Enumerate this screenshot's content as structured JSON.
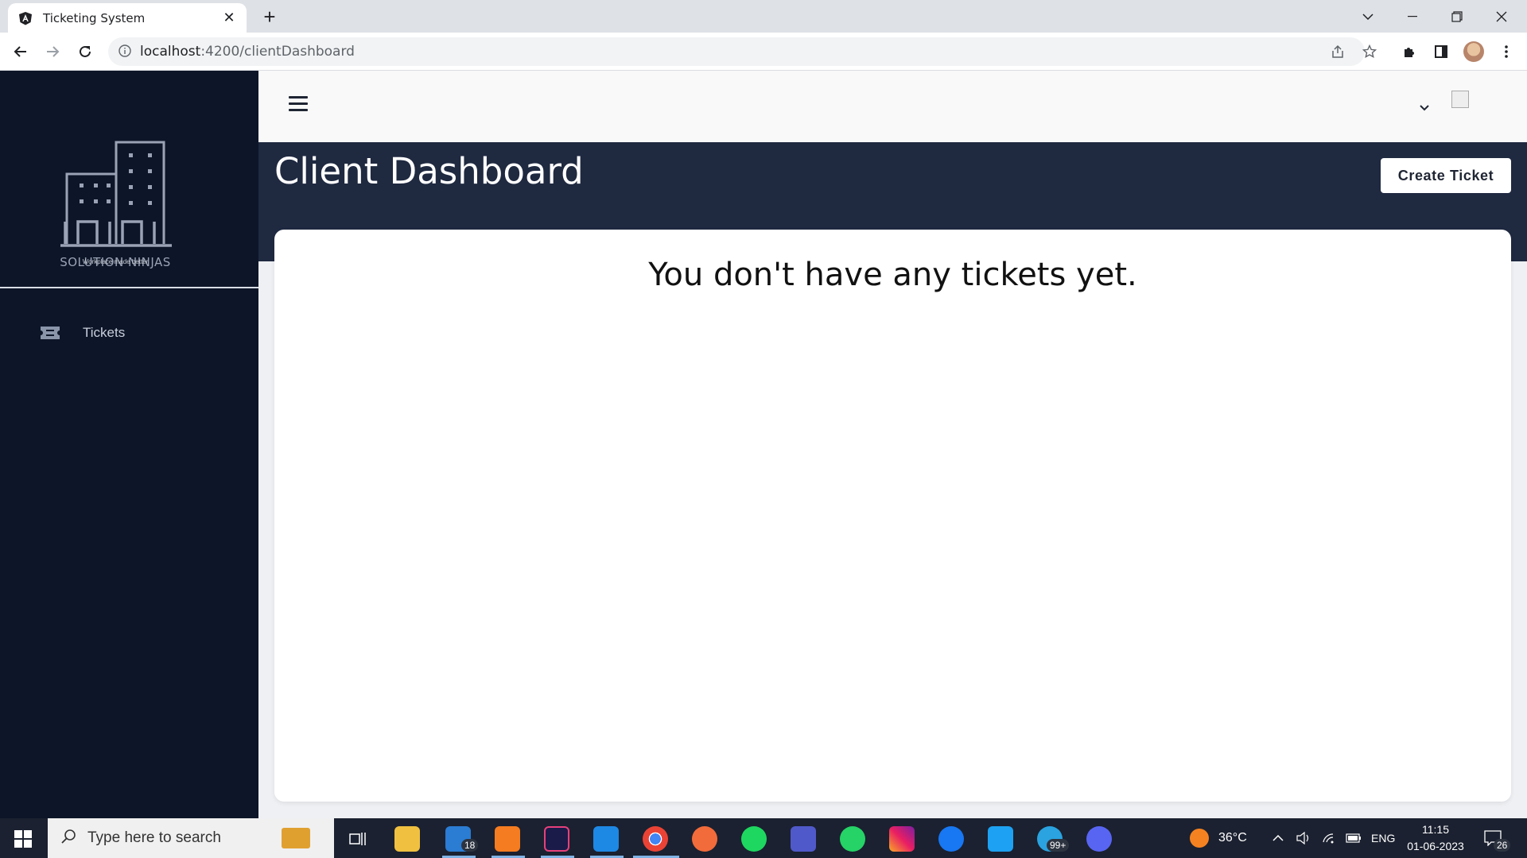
{
  "browser": {
    "tab_title": "Ticketing System",
    "tab_close": "✕",
    "new_tab": "+",
    "url_host": "localhost",
    "url_rest": ":4200/clientDashboard"
  },
  "sidebar": {
    "logo_name": "SOLUTION NINJAS",
    "logo_tagline": "Workplace made better",
    "items": [
      {
        "label": "Tickets",
        "icon": "ticket-icon"
      }
    ]
  },
  "page": {
    "title": "Client Dashboard",
    "create_button": "Create Ticket",
    "empty_message": "You don't have any tickets yet."
  },
  "taskbar": {
    "search_placeholder": "Type here to search",
    "mail_badge": "18",
    "telegram_badge": "99+",
    "weather": "36°C",
    "lang": "ENG",
    "time": "11:15",
    "date": "01-06-2023",
    "notifications": "26"
  },
  "colors": {
    "sidebar": "#0d1628",
    "header": "#1f2940",
    "accent": "#ffffff"
  }
}
